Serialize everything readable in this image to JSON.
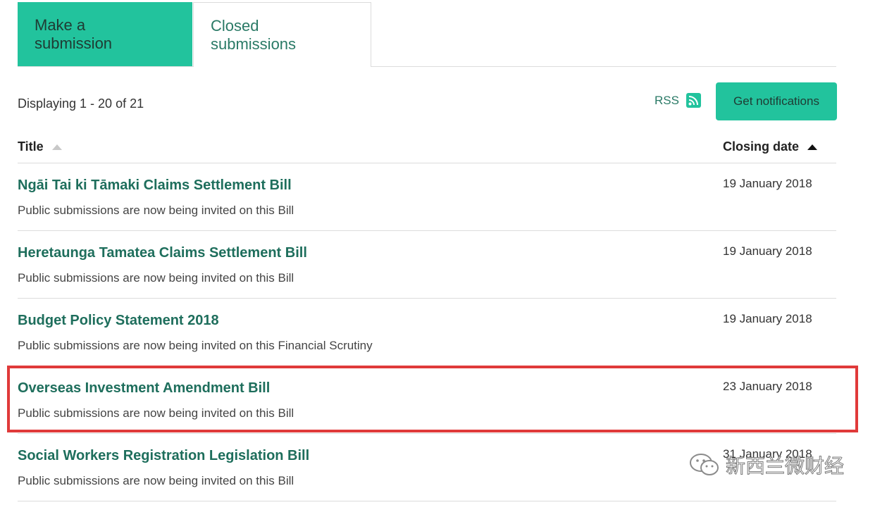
{
  "tabs": {
    "active_label": "Make a submission",
    "inactive_label": "Closed submissions"
  },
  "toolbar": {
    "count_text": "Displaying 1 - 20 of 21",
    "rss_label": "RSS",
    "notify_label": "Get notifications"
  },
  "table": {
    "col_title": "Title",
    "col_date": "Closing date",
    "rows": [
      {
        "title": "Ngāi Tai ki Tāmaki Claims Settlement Bill",
        "desc": "Public submissions are now being invited on this Bill",
        "date": "19 January 2018"
      },
      {
        "title": "Heretaunga Tamatea Claims Settlement Bill",
        "desc": "Public submissions are now being invited on this Bill",
        "date": "19 January 2018"
      },
      {
        "title": "Budget Policy Statement 2018",
        "desc": "Public submissions are now being invited on this Financial Scrutiny",
        "date": "19 January 2018"
      },
      {
        "title": "Overseas Investment Amendment Bill",
        "desc": "Public submissions are now being invited on this Bill",
        "date": "23 January 2018"
      },
      {
        "title": "Social Workers Registration Legislation Bill",
        "desc": "Public submissions are now being invited on this Bill",
        "date": "31 January 2018"
      }
    ]
  },
  "watermark": {
    "text": "新西兰微财经"
  },
  "colors": {
    "accent": "#22c39d",
    "link": "#1e6e5c",
    "highlight": "#e03a3a"
  }
}
